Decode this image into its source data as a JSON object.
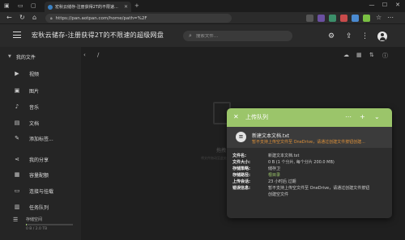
{
  "browser": {
    "tab_title": "宏秋云储存-注册获得2T的不限速...",
    "address": "https://pan.aotpan.com/home/path=%2F",
    "window_controls": [
      "—",
      "☐",
      "✕"
    ]
  },
  "header": {
    "title": "宏秋云储存-注册获得2T的不限速的超级网盘",
    "search_placeholder": "搜索文件..."
  },
  "sidebar": {
    "my_files": "我的文件",
    "items": [
      {
        "label": "视频",
        "icon": "video-icon"
      },
      {
        "label": "图片",
        "icon": "image-icon"
      },
      {
        "label": "音乐",
        "icon": "music-icon"
      },
      {
        "label": "文档",
        "icon": "document-icon"
      },
      {
        "label": "添加标签...",
        "icon": "tag-icon"
      },
      {
        "label": "我的分享",
        "icon": "share-icon"
      },
      {
        "label": "容量配额",
        "icon": "quota-icon"
      },
      {
        "label": "连接与挂载",
        "icon": "link-icon"
      },
      {
        "label": "任务队列",
        "icon": "task-icon"
      }
    ],
    "storage_label": "存储空间",
    "storage_usage": "0 B / 2.0 TB",
    "storage_fraction": 0.0
  },
  "main": {
    "path": "/",
    "empty_title": "拖拽",
    "empty_hint": "将文件拖动至此处上传"
  },
  "upload_panel": {
    "title": "上传队列",
    "file_name": "新建文本文档.txt",
    "error": "暂不支持上传空文件至 OneDrive，请通过创建文件按钮创建...",
    "details": [
      {
        "key": "文件名:",
        "value": "新建文本文档.txt"
      },
      {
        "key": "文件大小:",
        "value": "0 B (1 个分片, 每个分片 200.0 MB)"
      },
      {
        "key": "存储策略:",
        "value": "储存卫"
      },
      {
        "key": "存储路径:",
        "value": "根目录"
      },
      {
        "key": "上传会话:",
        "value": "23 小时后 过期"
      },
      {
        "key": "错误信息:",
        "value": "暂不支持上传空文件至 OneDrive，请通过创建文件按钮"
      },
      {
        "key": "",
        "value": "创建空文件"
      }
    ],
    "accent_color": "#9bc56a",
    "error_color": "#e0923a"
  }
}
